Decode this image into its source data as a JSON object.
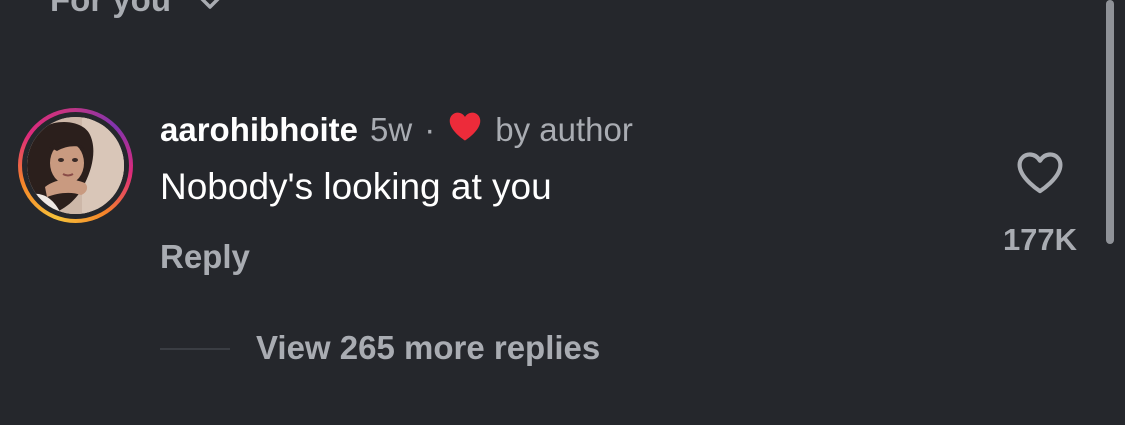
{
  "sort": {
    "label": "For you",
    "icon": "chevron-down-icon"
  },
  "comment": {
    "username": "aarohibhoite",
    "time": "5w",
    "separator": "·",
    "liked_by_author_icon": "red-heart-icon",
    "liked_by_author_label": "by author",
    "text": "Nobody's looking at you",
    "reply_label": "Reply",
    "like_icon": "heart-outline-icon",
    "like_count": "177K"
  },
  "replies": {
    "view_more_label": "View 265 more replies"
  },
  "colors": {
    "background": "#25272c",
    "primary_text": "#ffffff",
    "secondary_text": "#a9acb2",
    "heart_red": "#ed2b3a",
    "story_ring": [
      "#f6c23a",
      "#f58529",
      "#dd2a7b",
      "#8134af"
    ]
  }
}
